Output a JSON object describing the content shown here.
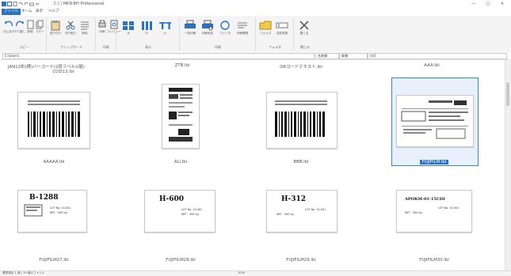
{
  "window": {
    "title": "C:\\ \\ MKN-BH Professional",
    "minimize": "—",
    "maximize": "□",
    "close": "✕"
  },
  "tabs": [
    {
      "label": "ファイル",
      "active": true
    },
    {
      "label": "ホーム",
      "active": false
    },
    {
      "label": "表示",
      "active": false
    },
    {
      "label": "ヘルプ",
      "active": false
    }
  ],
  "ribbon": {
    "groups": [
      {
        "label": "コピー",
        "buttons": [
          "元に戻す",
          "やり直し",
          "新規",
          "コピー"
        ]
      },
      {
        "label": "クリップボード",
        "buttons": [
          "貼り付け",
          "切り取り",
          "削除"
        ]
      },
      {
        "label": "印刷",
        "buttons": [
          "印刷",
          "プレビュー"
        ]
      },
      {
        "label": "表示",
        "buttons": [
          "大",
          "中",
          "小"
        ]
      },
      {
        "label": "印刷",
        "buttons": [
          "一括印刷",
          "印刷設定",
          "プリンタ",
          "印刷履歴"
        ]
      },
      {
        "label": "フォルダ",
        "buttons": [
          "フォルダ",
          "名前変更"
        ]
      },
      {
        "label": "閉じる",
        "buttons": [
          "閉じる"
        ]
      }
    ]
  },
  "pathbar": {
    "path": "C:\\Users\\",
    "sort_label": "名前順",
    "sort_value": "昇順",
    "search_placeholder": "検索"
  },
  "files": [
    {
      "name": "JAN13桁(横)バーコード(2段ラベル)(縦)",
      "name2": "COD13.lbl",
      "selected": false
    },
    {
      "name": "ZTB.lbl",
      "selected": false
    },
    {
      "name": "QRコードテキスト.lbl",
      "selected": false
    },
    {
      "name": "AAA.lbl",
      "selected": false
    },
    {
      "name": "AAAAA.lbl",
      "selected": false
    },
    {
      "name": "ALl.lbl",
      "selected": false
    },
    {
      "name": "BBB.lbl",
      "selected": false
    },
    {
      "name": "FUJIFILM.lbl",
      "selected": true
    },
    {
      "name": "FUJIFILM27.lbl",
      "selected": false
    },
    {
      "name": "FUJIFILM28.lbl",
      "selected": false
    },
    {
      "name": "FUJIFILM29.lbl",
      "selected": false
    },
    {
      "name": "FUJIFILM30.lbl",
      "selected": false
    }
  ],
  "labels_text": {
    "code_b": "B-1288",
    "code_h1": "H-600",
    "code_h2": "H-312",
    "code_multi": "APOKM-01-15CDI",
    "lot": "LOT No. 10-001",
    "net": "NET · 500 kg"
  },
  "status": {
    "text": "選択項目 1 個 / 19 個のファイル",
    "right": "1000"
  },
  "colors": {
    "accent": "#2b72c2",
    "selection": "#3c84d6"
  }
}
